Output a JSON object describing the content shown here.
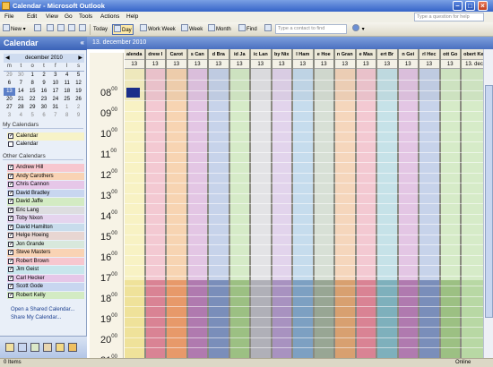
{
  "window": {
    "title": "Calendar - Microsoft Outlook"
  },
  "menu": {
    "items": [
      "File",
      "Edit",
      "View",
      "Go",
      "Tools",
      "Actions",
      "Help"
    ],
    "ask_placeholder": "Type a question for help"
  },
  "toolbar": {
    "new_label": "New",
    "today_label": "Today",
    "day_label": "Day",
    "work_week_label": "Work Week",
    "week_label": "Week",
    "month_label": "Month",
    "find_label": "Find",
    "contact_placeholder": "Type a contact to find"
  },
  "nav": {
    "title": "Calendar",
    "mini_calendar": {
      "month_label": "december 2010",
      "weekdays": [
        "m",
        "t",
        "o",
        "t",
        "f",
        "l",
        "s"
      ],
      "weeks": [
        [
          "29",
          "30",
          "1",
          "2",
          "3",
          "4",
          "5"
        ],
        [
          "6",
          "7",
          "8",
          "9",
          "10",
          "11",
          "12"
        ],
        [
          "13",
          "14",
          "15",
          "16",
          "17",
          "18",
          "19"
        ],
        [
          "20",
          "21",
          "22",
          "23",
          "24",
          "25",
          "26"
        ],
        [
          "27",
          "28",
          "29",
          "30",
          "31",
          "1",
          "2"
        ],
        [
          "3",
          "4",
          "5",
          "6",
          "7",
          "8",
          "9"
        ]
      ],
      "selected_day": "13"
    },
    "my_calendars_title": "My Calendars",
    "my_calendars": [
      {
        "label": "Calendar",
        "checked": true,
        "color": "#f7f3c8"
      },
      {
        "label": "Calendar",
        "checked": false,
        "color": "#e9eff8"
      }
    ],
    "other_calendars_title": "Other Calendars",
    "other_calendars": [
      {
        "label": "Andrew Hill",
        "color": "#f7c7cf"
      },
      {
        "label": "Andy Carothers",
        "color": "#f9d3b4"
      },
      {
        "label": "Chris Cannon",
        "color": "#e6c7e8"
      },
      {
        "label": "David Bradley",
        "color": "#c8d6f0"
      },
      {
        "label": "David Jaffe",
        "color": "#d3ebc3"
      },
      {
        "label": "Eric Lang",
        "color": "#dddde0"
      },
      {
        "label": "Toby Nixon",
        "color": "#e5d4ee"
      },
      {
        "label": "David Hamilton",
        "color": "#c8dcec"
      },
      {
        "label": "Helge Hoeing",
        "color": "#e8d6d2"
      },
      {
        "label": "Jon Grande",
        "color": "#d8e8dc"
      },
      {
        "label": "Steve Masters",
        "color": "#f9d3b4"
      },
      {
        "label": "Robert Brown",
        "color": "#f7c7cf"
      },
      {
        "label": "Jim Geist",
        "color": "#c8e6ec"
      },
      {
        "label": "Carl Hecker",
        "color": "#e6c7e8"
      },
      {
        "label": "Scott Gode",
        "color": "#c8d6f0"
      },
      {
        "label": "Robert Kelly",
        "color": "#d3ebc3"
      }
    ],
    "links": [
      "Open a Shared Calendar...",
      "Share My Calendar..."
    ]
  },
  "calendar": {
    "title": "13. december 2010",
    "hours": [
      "08",
      "09",
      "10",
      "11",
      "12",
      "13",
      "14",
      "15",
      "16",
      "17",
      "18",
      "19",
      "20",
      "21"
    ],
    "minute_suffix": "00",
    "columns": [
      {
        "name": "alenda",
        "date": "13",
        "work": "#f8f2c4",
        "after": "#efe29a"
      },
      {
        "name": "drew I",
        "date": "13",
        "work": "#f3c9d2",
        "after": "#d98394"
      },
      {
        "name": "Carot",
        "date": "13",
        "work": "#f7d4b2",
        "after": "#e7996a"
      },
      {
        "name": "s Can",
        "date": "13",
        "work": "#e3c6e4",
        "after": "#b07aaf"
      },
      {
        "name": "d Bra",
        "date": "13",
        "work": "#c7d3ea",
        "after": "#7a8eba"
      },
      {
        "name": "id Ja",
        "date": "13",
        "work": "#d6ebc8",
        "after": "#9cc083"
      },
      {
        "name": "ic Lan",
        "date": "13",
        "work": "#e3e3e6",
        "after": "#b0b0b8"
      },
      {
        "name": "by Nix",
        "date": "13",
        "work": "#e2d4ec",
        "after": "#a892c0"
      },
      {
        "name": "l Ham",
        "date": "13",
        "work": "#c6dced",
        "after": "#7da0c2"
      },
      {
        "name": "e Hoe",
        "date": "13",
        "work": "#d8e0d6",
        "after": "#98a694"
      },
      {
        "name": "n Gran",
        "date": "13",
        "work": "#f5d6bc",
        "after": "#d8a070"
      },
      {
        "name": "e Mas",
        "date": "13",
        "work": "#f3c9d2",
        "after": "#d98394"
      },
      {
        "name": "ert Br",
        "date": "13",
        "work": "#c6e2e8",
        "after": "#7eb0bc"
      },
      {
        "name": "n Gei",
        "date": "13",
        "work": "#e3c6e4",
        "after": "#b07aaf"
      },
      {
        "name": "rl Hec",
        "date": "13",
        "work": "#c7d3ea",
        "after": "#7a8eba"
      },
      {
        "name": "ott Go",
        "date": "13",
        "work": "#d6ebc8",
        "after": "#9cc083"
      },
      {
        "name": "obert Kel",
        "date": "13. dec",
        "work": "#d6ebc8",
        "after": "#b8d8a4"
      }
    ]
  },
  "status": {
    "items_label": "0 Items",
    "online_label": "Online"
  }
}
